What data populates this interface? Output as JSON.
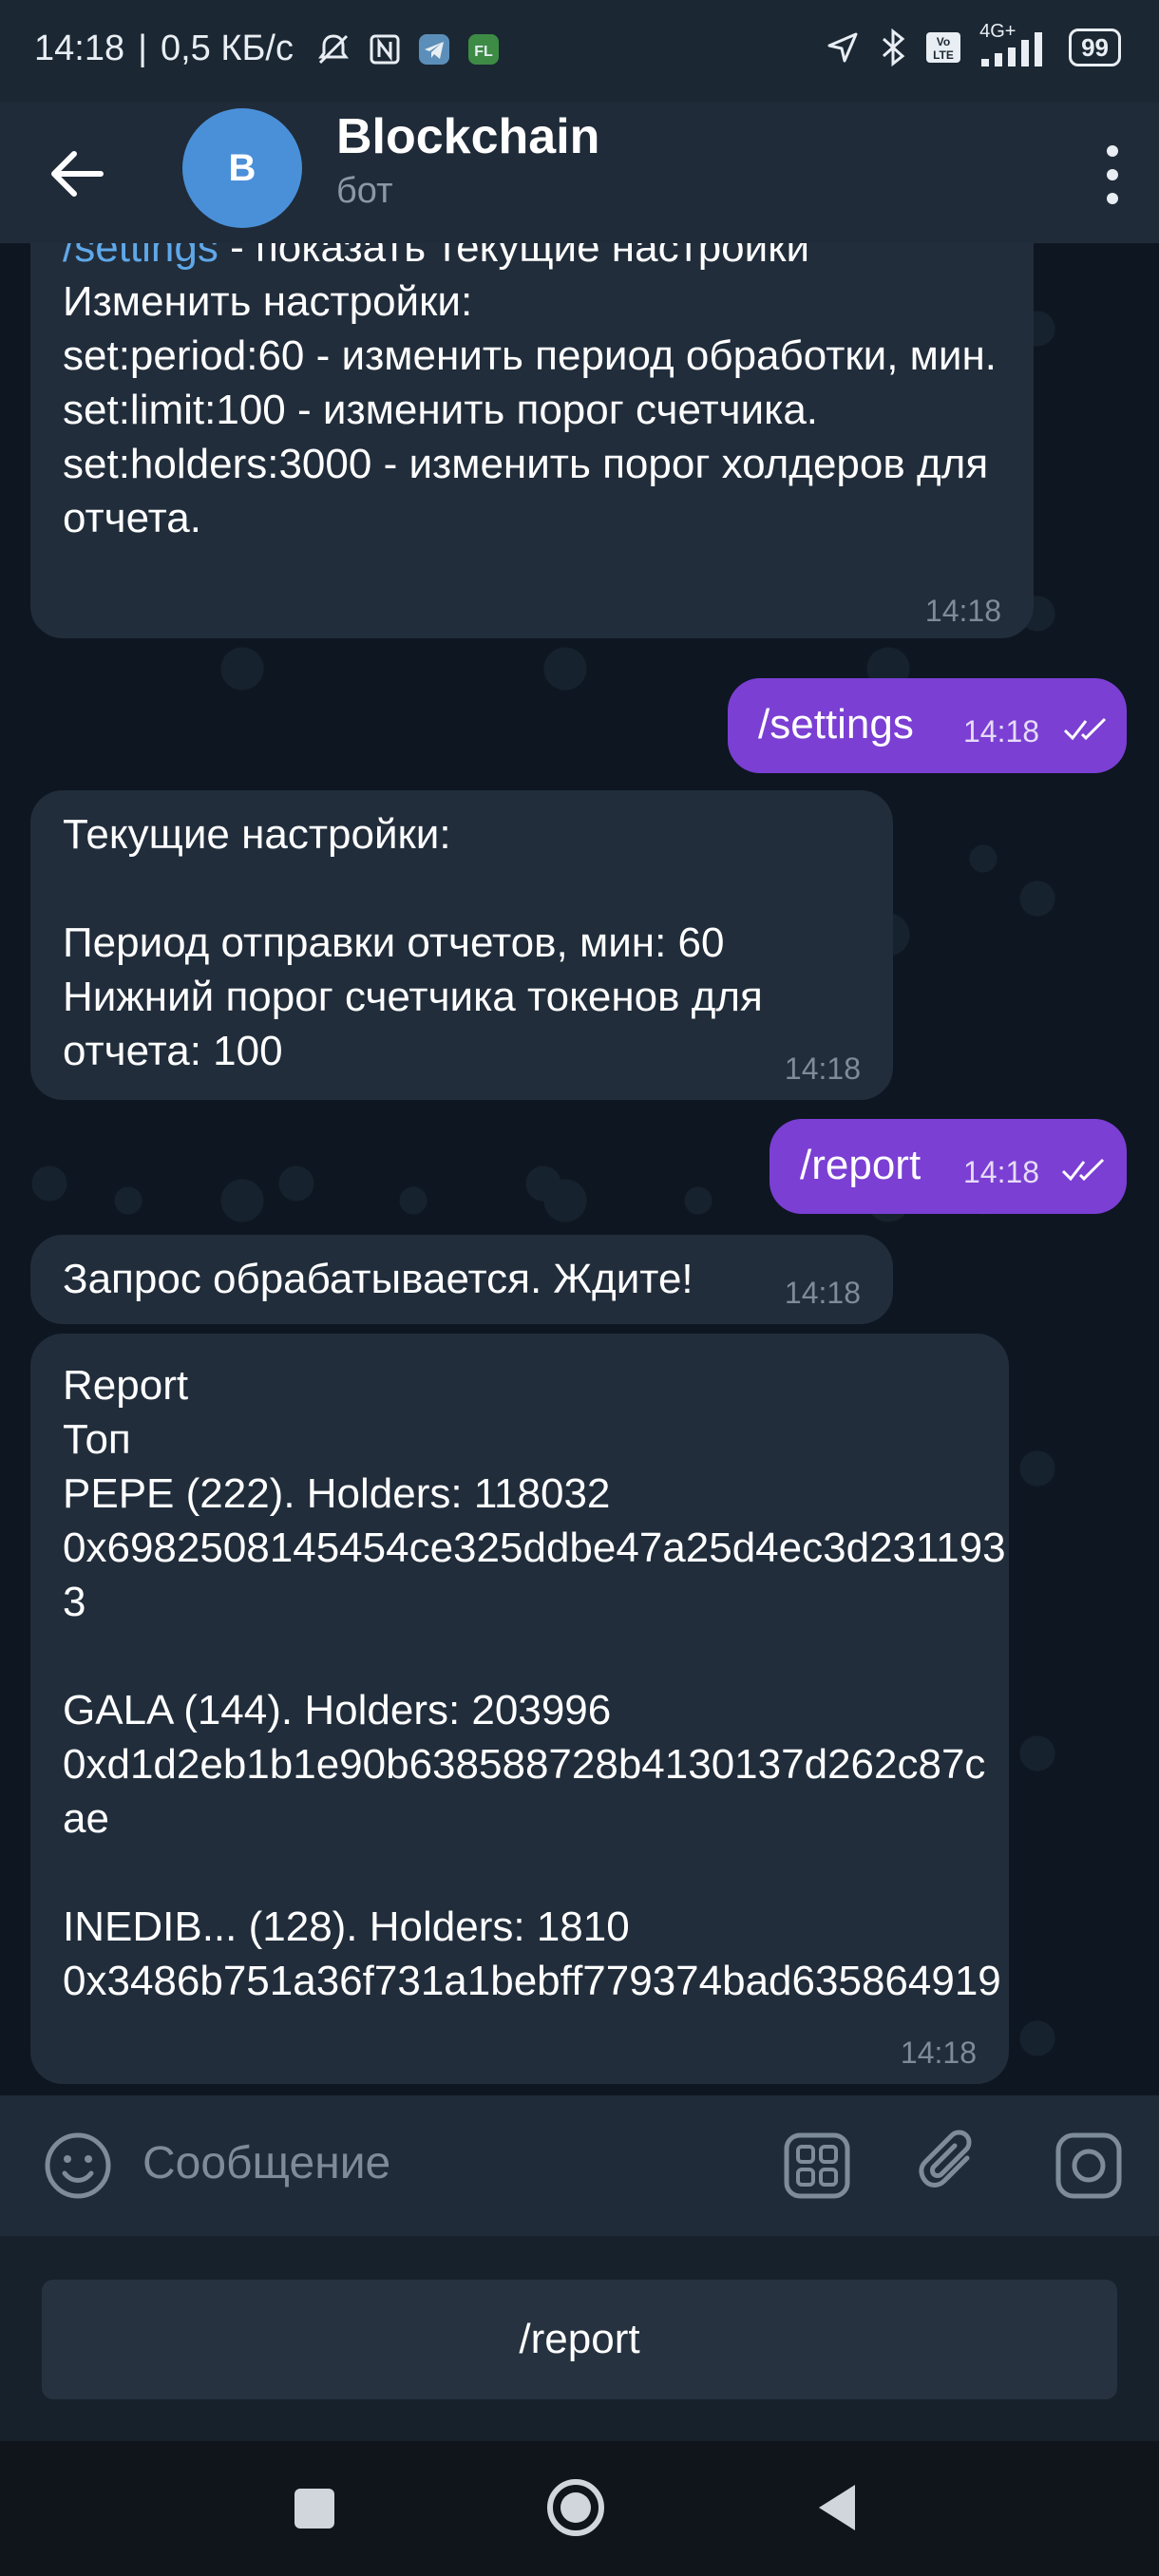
{
  "status_bar": {
    "time": "14:18",
    "net_speed": "0,5 КБ/с",
    "battery": "99",
    "network_badge": "4G+",
    "volte_badge": "Vo LTE",
    "app_badge": "FL"
  },
  "header": {
    "title": "Blockchain",
    "subtitle": "бот",
    "avatar_letter": "B"
  },
  "messages": [
    {
      "direction": "in",
      "text_link": "/settings",
      "text_after_link": " - показать текущие настройки",
      "text": "\nИзменить настройки:\nset:period:60 - изменить период обработки, мин.\nset:limit:100 - изменить порог счетчика.\nset:holders:3000 - изменить порог холдеров для отчета.",
      "time": "14:18"
    },
    {
      "direction": "out",
      "text": "/settings",
      "time": "14:18"
    },
    {
      "direction": "in",
      "text": "Текущие настройки:\n\nПериод отправки отчетов, мин: 60\nНижний порог счетчика токенов для отчета: 100",
      "time": "14:18"
    },
    {
      "direction": "out",
      "text": "/report",
      "time": "14:18"
    },
    {
      "direction": "in",
      "text": "Запрос обрабатывается. Ждите!",
      "time": "14:18"
    },
    {
      "direction": "in",
      "text": "Report\nТоп\nPEPE (222). Holders: 118032\n0x6982508145454ce325ddbe47a25d4ec3d2311933\n\nGALA (144). Holders: 203996\n0xd1d2eb1b1e90b638588728b4130137d262c87cae\n\nINEDIB... (128). Holders: 1810\n0x3486b751a36f731a1bebff779374bad635864919",
      "time": "14:18"
    }
  ],
  "composer": {
    "placeholder": "Сообщение"
  },
  "bot_keyboard": {
    "button_label": "/report"
  },
  "colors": {
    "background": "#0e1621",
    "incoming_bubble": "#212d3b",
    "outgoing_bubble": "#7b3fd4",
    "header": "#1f2b38",
    "link": "#5fa8e8",
    "avatar": "#4a90d9"
  }
}
